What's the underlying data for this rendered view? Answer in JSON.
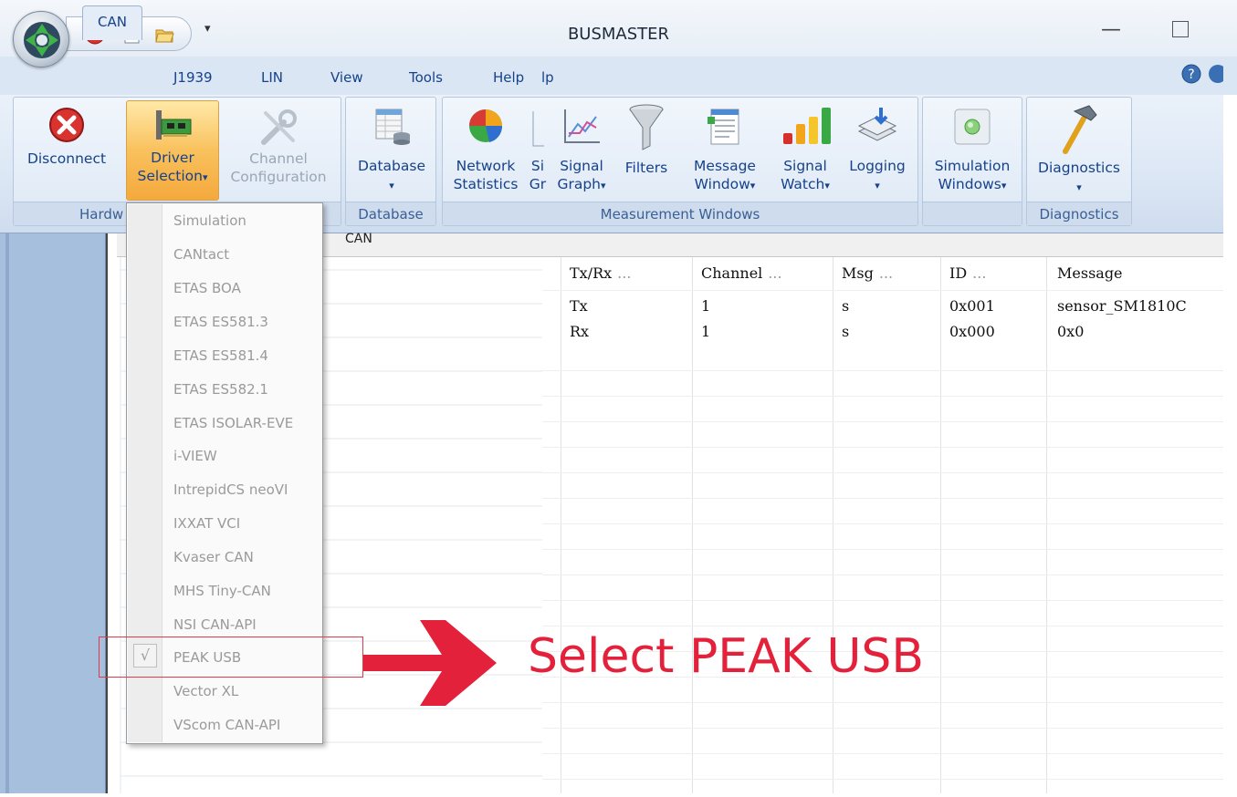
{
  "window": {
    "title": "BUSMASTER",
    "minimize_glyph": "—"
  },
  "quick_access": {
    "dropdown_glyph": "▾"
  },
  "tabs": [
    {
      "label": "CAN"
    },
    {
      "label": "J1939"
    },
    {
      "label": "LIN"
    },
    {
      "label": "View"
    },
    {
      "label": "Tools"
    },
    {
      "label": "Help"
    },
    {
      "label": "lp"
    }
  ],
  "ribbon": {
    "disconnect": "Disconnect",
    "driver_selection": [
      "Driver",
      "Selection"
    ],
    "channel_configuration": [
      "Channel",
      "Configuration"
    ],
    "database": "Database",
    "network_statistics": [
      "Network",
      "Statistics"
    ],
    "signal_graph_cut": [
      "Si",
      "Gr"
    ],
    "signal_graph": [
      "Signal",
      "Graph"
    ],
    "filters": "Filters",
    "message_window": [
      "Message",
      "Window"
    ],
    "signal_watch": [
      "Signal",
      "Watch"
    ],
    "logging": "Logging",
    "simulation_windows": [
      "Simulation",
      "Windows"
    ],
    "diagnostics": "Diagnostics",
    "dropdown_caret": "▾",
    "groups": {
      "hardware": "Hardw",
      "database": "Database",
      "measurement_windows": "Measurement Windows",
      "diagnostics": "Diagnostics"
    }
  },
  "pane_header": "CAN",
  "driver_menu": {
    "items": [
      "Simulation",
      "CANtact",
      "ETAS BOA",
      "ETAS ES581.3",
      "ETAS ES581.4",
      "ETAS ES582.1",
      "ETAS ISOLAR-EVE",
      "i-VIEW",
      "IntrepidCS neoVI",
      "IXXAT VCI",
      "Kvaser CAN",
      "MHS Tiny-CAN",
      "NSI CAN-API",
      "PEAK USB",
      "Vector XL",
      "VScom CAN-API"
    ],
    "checked_item": "PEAK USB",
    "check_glyph": "√"
  },
  "message_table": {
    "columns": [
      {
        "label": "Tx/Rx",
        "dots": "..."
      },
      {
        "label": "Channel",
        "dots": "..."
      },
      {
        "label": "Msg",
        "dots": "..."
      },
      {
        "label": "ID",
        "dots": "..."
      },
      {
        "label": "Message",
        "dots": ""
      }
    ],
    "rows": [
      [
        "Tx",
        "1",
        "s",
        "0x001",
        "sensor_SM1810C"
      ],
      [
        "Rx",
        "1",
        "s",
        "0x000",
        "0x0"
      ]
    ]
  },
  "annotation": {
    "text": "Select PEAK USB",
    "color": "#e4213a"
  }
}
